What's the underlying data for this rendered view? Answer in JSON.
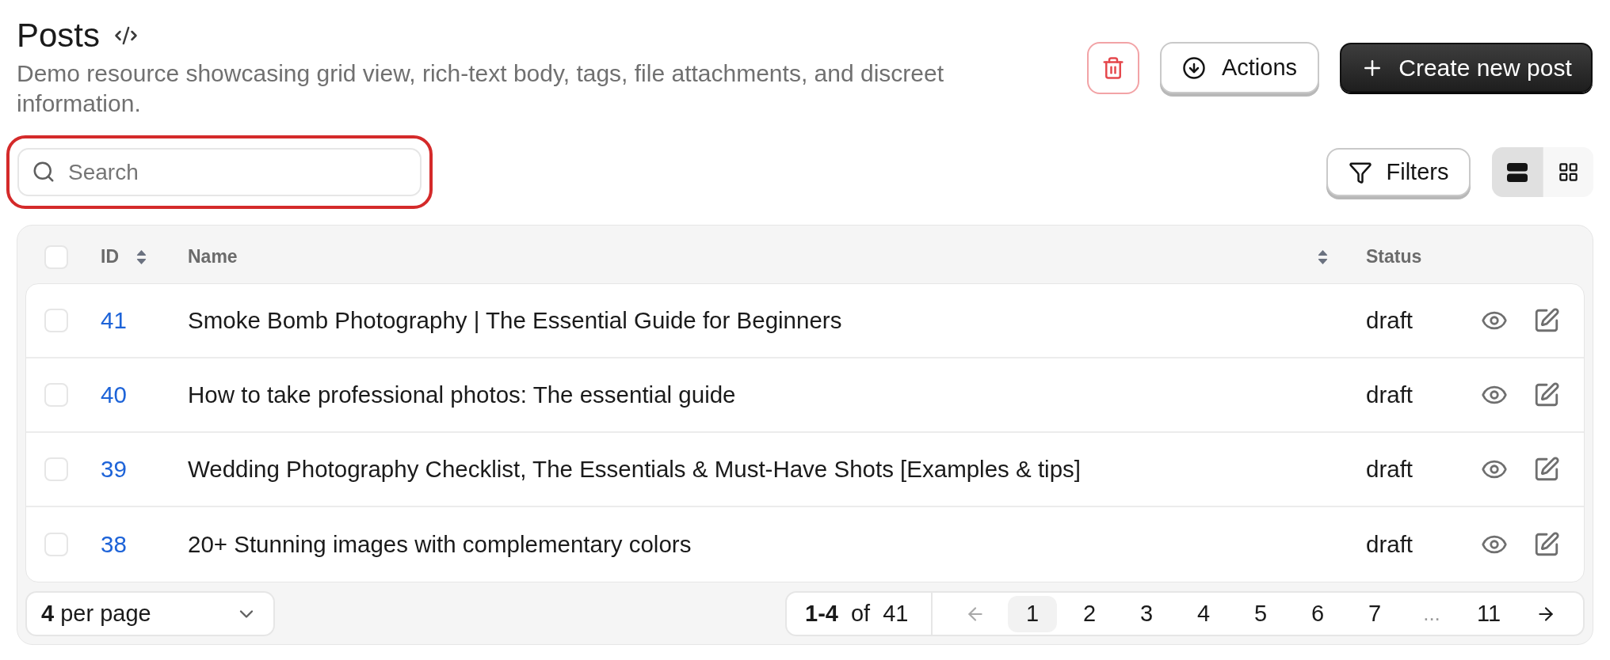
{
  "header": {
    "title": "Posts",
    "description": "Demo resource showcasing grid view, rich-text body, tags, file attachments, and discreet information."
  },
  "toolbar": {
    "actions_button": "Actions",
    "create_button": "Create new post"
  },
  "search": {
    "placeholder": "Search"
  },
  "filters_button": "Filters",
  "view_toggle": [
    {
      "kind": "list",
      "selected": true
    },
    {
      "kind": "grid",
      "selected": false
    }
  ],
  "table": {
    "select_all_checked": false,
    "columns": [
      {
        "label": "ID",
        "sortable": true
      },
      {
        "label": "Name",
        "sortable": true
      },
      {
        "label": "Status",
        "sortable": false
      }
    ],
    "rows": [
      {
        "id": "41",
        "name": "Smoke Bomb Photography | The Essential Guide for Beginners",
        "status": "draft",
        "checked": false
      },
      {
        "id": "40",
        "name": "How to take professional photos: The essential guide",
        "status": "draft",
        "checked": false
      },
      {
        "id": "39",
        "name": "Wedding Photography Checklist, The Essentials & Must-Have Shots [Examples & tips]",
        "status": "draft",
        "checked": false
      },
      {
        "id": "38",
        "name": "20+ Stunning images with complementary colors",
        "status": "draft",
        "checked": false
      }
    ]
  },
  "pagination": {
    "per_page": "**4** per page",
    "range": "**1-4** of 41",
    "prev_disabled": true,
    "next_disabled": false,
    "pages": [
      {
        "kind": "page",
        "label": "1",
        "selected": true
      },
      {
        "kind": "page",
        "label": "2",
        "selected": false
      },
      {
        "kind": "page",
        "label": "3",
        "selected": false
      },
      {
        "kind": "page",
        "label": "4",
        "selected": false
      },
      {
        "kind": "page",
        "label": "5",
        "selected": false
      },
      {
        "kind": "page",
        "label": "6",
        "selected": false
      },
      {
        "kind": "page",
        "label": "7",
        "selected": false
      },
      {
        "kind": "ellipsis",
        "label": "...",
        "selected": false
      },
      {
        "kind": "page",
        "label": "11",
        "selected": false
      }
    ]
  }
}
